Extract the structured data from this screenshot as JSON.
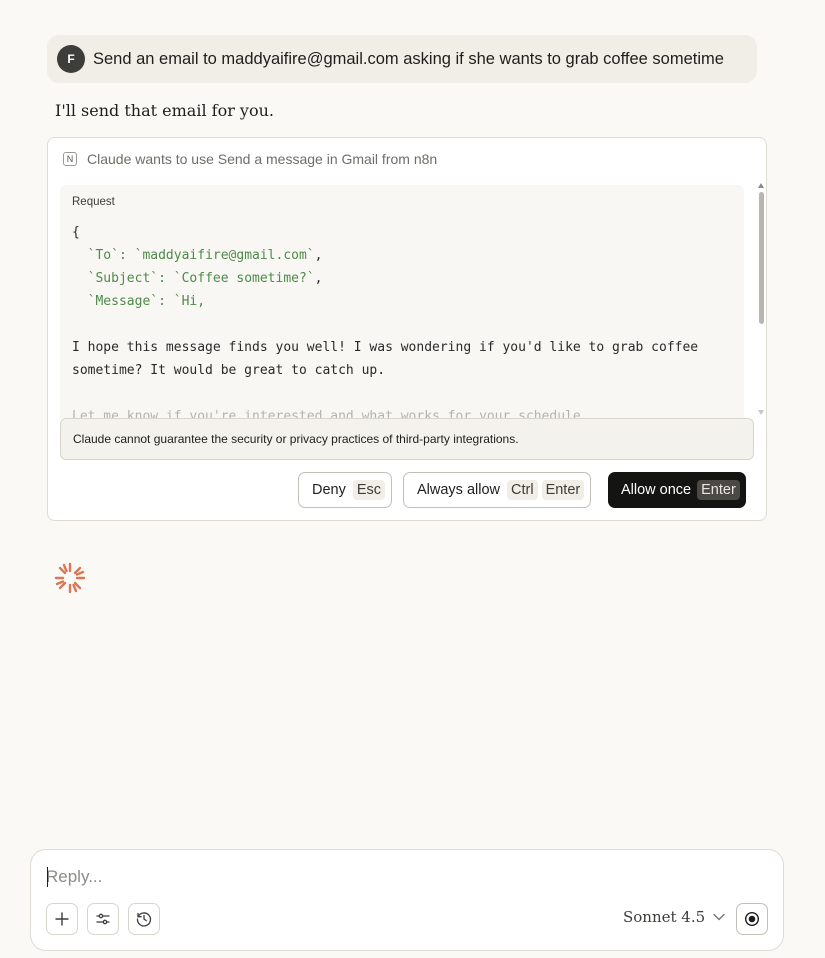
{
  "user_message": {
    "avatar_initial": "F",
    "text": "Send an email to maddyaifire@gmail.com asking if she wants to grab coffee sometime"
  },
  "assistant": {
    "text": "I'll send that email for you."
  },
  "tool_request": {
    "integration_icon": "N",
    "title": "Claude wants to use Send a message in Gmail from n8n",
    "request_label": "Request",
    "code": {
      "open_brace": "{",
      "to_key": "`To`",
      "to_value": "`maddyaifire@gmail.com`",
      "subject_key": "`Subject`",
      "subject_value": "`Coffee sometime?`",
      "message_key": "`Message`",
      "message_value": "`Hi,",
      "body_line1": "I hope this message finds you well! I was wondering if you'd like to grab coffee sometime? It would be great to catch up.",
      "body_line2": "Let me know if you're interested and what works for your schedule."
    },
    "warning": "Claude cannot guarantee the security or privacy practices of third-party integrations.",
    "buttons": {
      "deny_label": "Deny",
      "deny_key": "Esc",
      "always_label": "Always allow",
      "always_key1": "Ctrl",
      "always_key2": "Enter",
      "once_label": "Allow once",
      "once_key": "Enter"
    }
  },
  "composer": {
    "placeholder": "Reply...",
    "model_label": "Sonnet 4.5",
    "icons": [
      "plus-icon",
      "sliders-icon",
      "history-icon",
      "voice-icon"
    ]
  },
  "colors": {
    "background": "#faf9f5",
    "accent_spinner": "#d97757",
    "primary_button": "#141413",
    "code_string": "#4e8a4a"
  }
}
